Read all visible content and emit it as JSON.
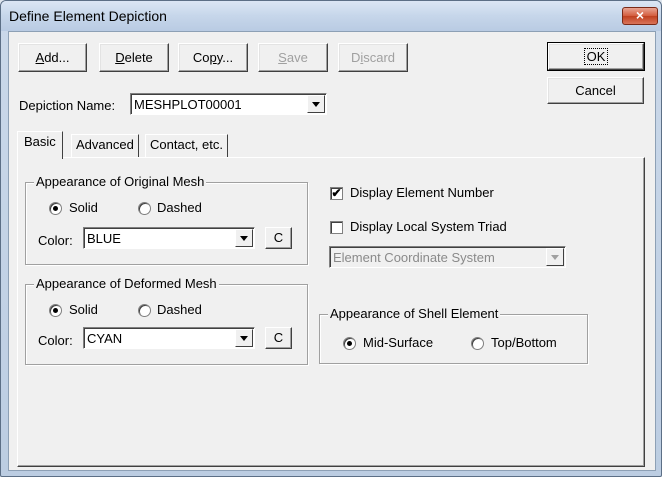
{
  "window": {
    "title": "Define Element Depiction",
    "close_glyph": "×"
  },
  "toolbar": {
    "add": {
      "pre": "",
      "key": "A",
      "post": "dd..."
    },
    "delete": {
      "pre": "",
      "key": "D",
      "post": "elete"
    },
    "copy": {
      "pre": "Co",
      "key": "p",
      "post": "y..."
    },
    "save": {
      "pre": "",
      "key": "S",
      "post": "ave"
    },
    "discard": {
      "pre": "D",
      "key": "i",
      "post": "scard"
    }
  },
  "dialog_buttons": {
    "ok": "OK",
    "cancel": "Cancel"
  },
  "depiction": {
    "label": "Depiction Name:",
    "value": "MESHPLOT00001"
  },
  "tabs": [
    "Basic",
    "Advanced",
    "Contact, etc."
  ],
  "original_mesh": {
    "title": "Appearance of Original Mesh",
    "solid_label": "Solid",
    "dashed_label": "Dashed",
    "selected": "Solid",
    "color_label": "Color:",
    "color_value": "BLUE",
    "color_button": "C"
  },
  "deformed_mesh": {
    "title": "Appearance of Deformed Mesh",
    "solid_label": "Solid",
    "dashed_label": "Dashed",
    "selected": "Solid",
    "color_label": "Color:",
    "color_value": "CYAN",
    "color_button": "C"
  },
  "display": {
    "element_number_label": "Display Element Number",
    "element_number_checked": true,
    "local_triad_label": "Display Local System Triad",
    "local_triad_checked": false,
    "coordinate_system_value": "Element Coordinate System",
    "check_mark": "✔"
  },
  "shell": {
    "title": "Appearance of Shell Element",
    "mid_surface_label": "Mid-Surface",
    "top_bottom_label": "Top/Bottom",
    "selected": "Mid-Surface"
  }
}
